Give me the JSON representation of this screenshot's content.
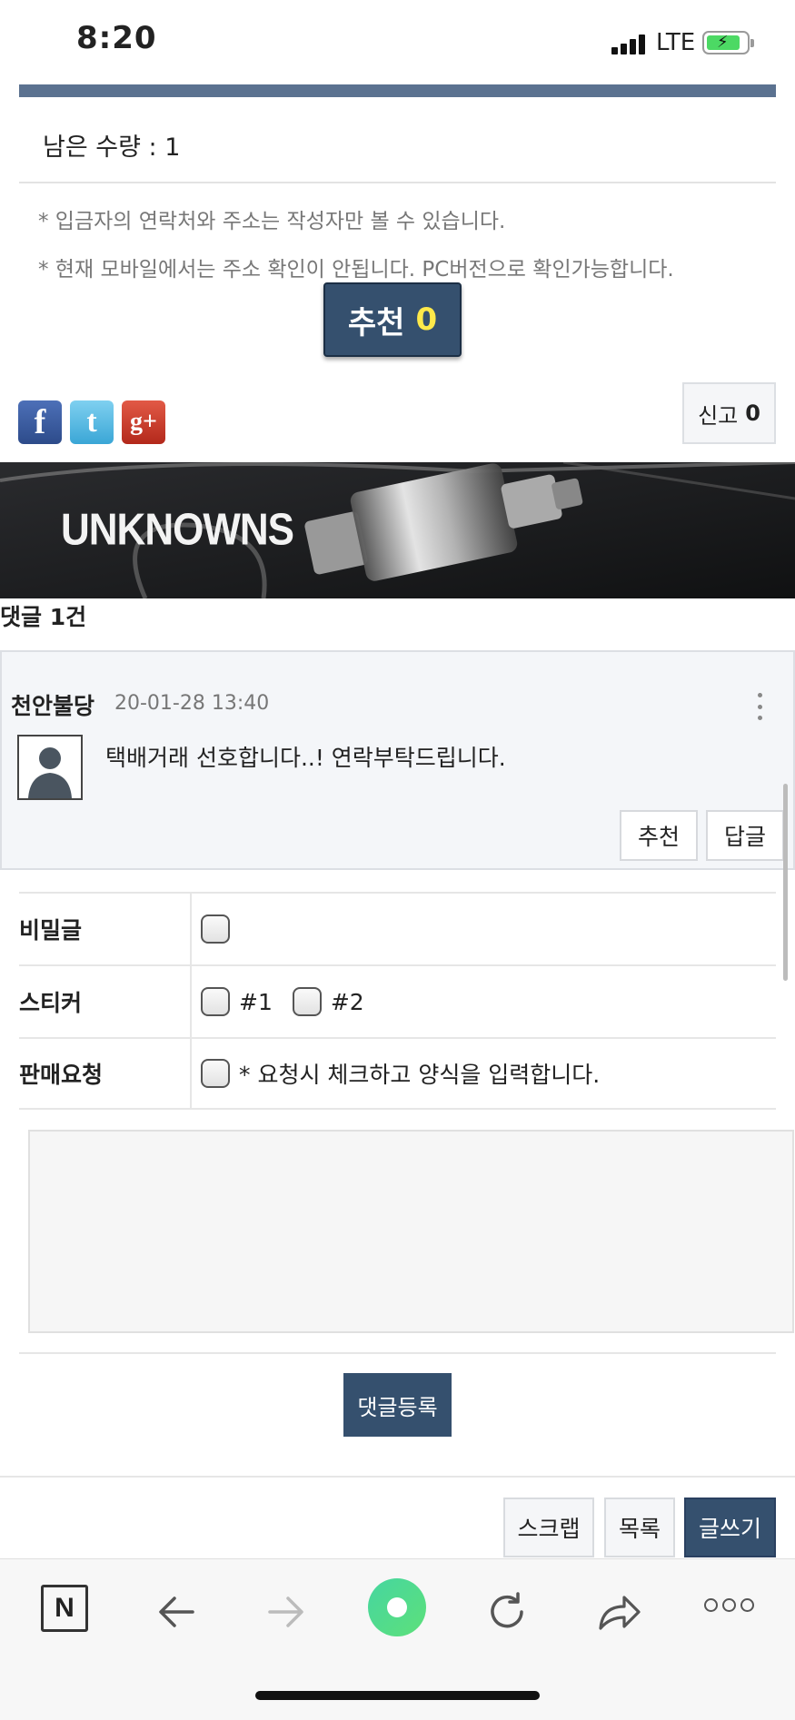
{
  "status_bar": {
    "time": "8:20",
    "network": "LTE"
  },
  "post": {
    "remaining": "남은 수량 : 1",
    "notices": [
      "* 입금자의 연락처와 주소는 작성자만 볼 수 있습니다.",
      "* 현재 모바일에서는 주소 확인이 안됩니다. PC버전으로 확인가능합니다."
    ],
    "recommend_label": "추천",
    "recommend_count": "0",
    "report_label": "신고",
    "report_count": "0"
  },
  "social": [
    {
      "name": "facebook",
      "glyph": "f"
    },
    {
      "name": "twitter",
      "glyph": "t"
    },
    {
      "name": "google-plus",
      "glyph": "g+"
    }
  ],
  "banner": {
    "text": "UNKNOWNS"
  },
  "comments": {
    "count_label": "댓글 1건",
    "items": [
      {
        "author": "천안불당",
        "date": "20-01-28 13:40",
        "text": "택배거래 선호합니다..! 연락부탁드립니다.",
        "recommend_label": "추천",
        "reply_label": "답글"
      }
    ]
  },
  "form": {
    "secret_label": "비밀글",
    "sticker_label": "스티커",
    "sticker_options": [
      "#1",
      "#2"
    ],
    "sale_label": "판매요청",
    "sale_desc": "* 요청시 체크하고 양식을 입력합니다.",
    "submit_label": "댓글등록"
  },
  "actions": {
    "scrap": "스크랩",
    "list": "목록",
    "write": "글쓰기"
  },
  "browser": {
    "home_label": "N"
  },
  "colors": {
    "accent": "#35506e",
    "recommend_count": "#ffe94a",
    "top_bar": "#5b7290"
  }
}
